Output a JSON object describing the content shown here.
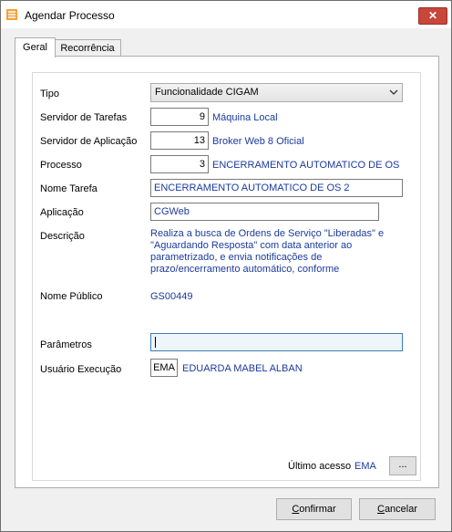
{
  "window": {
    "title": "Agendar Processo",
    "close_glyph": "✕"
  },
  "tabs": [
    {
      "label": "Geral",
      "active": true
    },
    {
      "label": "Recorrência",
      "active": false
    }
  ],
  "form": {
    "tipo": {
      "label": "Tipo",
      "value": "Funcionalidade CIGAM"
    },
    "servidor_tarefas": {
      "label": "Servidor de Tarefas",
      "code": "9",
      "name": "Máquina Local"
    },
    "servidor_aplicacao": {
      "label": "Servidor de Aplicação",
      "code": "13",
      "name": "Broker Web 8 Oficial"
    },
    "processo": {
      "label": "Processo",
      "code": "3",
      "name": "ENCERRAMENTO AUTOMATICO DE OS"
    },
    "nome_tarefa": {
      "label": "Nome Tarefa",
      "value": "ENCERRAMENTO AUTOMATICO DE OS 2"
    },
    "aplicacao": {
      "label": "Aplicação",
      "value": "CGWeb"
    },
    "descricao": {
      "label": "Descrição",
      "value": "Realiza a busca de Ordens de Serviço \"Liberadas\" e \"Aguardando Resposta\" com data anterior ao parametrizado, e envia notificações de prazo/encerramento automático, conforme"
    },
    "nome_publico": {
      "label": "Nome Público",
      "value": "GS00449"
    },
    "parametros": {
      "label": "Parâmetros",
      "value": ""
    },
    "usuario_execucao": {
      "label": "Usuário Execução",
      "code": "EMA",
      "name": "EDUARDA MABEL ALBAN"
    },
    "ultimo_acesso": {
      "label": "Último acesso",
      "value": "EMA"
    },
    "ellipsis_label": "..."
  },
  "buttons": {
    "confirmar": {
      "first": "C",
      "rest": "onfirmar"
    },
    "cancelar": {
      "first": "C",
      "rest": "ancelar"
    }
  },
  "colors": {
    "value_text": "#1a3a9e",
    "close": "#c8463a",
    "focus": "#3c7fb1"
  }
}
